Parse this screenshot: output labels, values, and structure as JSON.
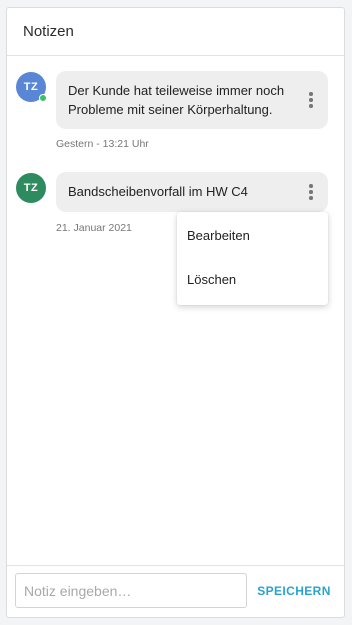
{
  "panel": {
    "title": "Notizen"
  },
  "colors": {
    "accent": "#2aa3cf",
    "avatar_blue": "#5a86d6",
    "avatar_green": "#2e8a5f",
    "online_green": "#39c26a",
    "bubble_bg": "#eeeeee"
  },
  "notes": [
    {
      "initials": "TZ",
      "avatar_color": "#5a86d6",
      "online": true,
      "text": "Der Kunde hat teileweise immer noch Probleme mit seiner Körperhaltung.",
      "timestamp": "Gestern - 13:21 Uhr",
      "menu_icon": "more-vertical-icon"
    },
    {
      "initials": "TZ",
      "avatar_color": "#2e8a5f",
      "online": false,
      "text": "Bandscheibenvorfall im HW C4",
      "timestamp": "21. Januar 2021",
      "menu_icon": "more-vertical-icon"
    }
  ],
  "context_menu": {
    "open_for_note": 1,
    "items": [
      {
        "label": "Bearbeiten"
      },
      {
        "label": "Löschen"
      }
    ]
  },
  "composer": {
    "placeholder": "Notiz eingeben…",
    "value": "",
    "save_label": "SPEICHERN"
  }
}
